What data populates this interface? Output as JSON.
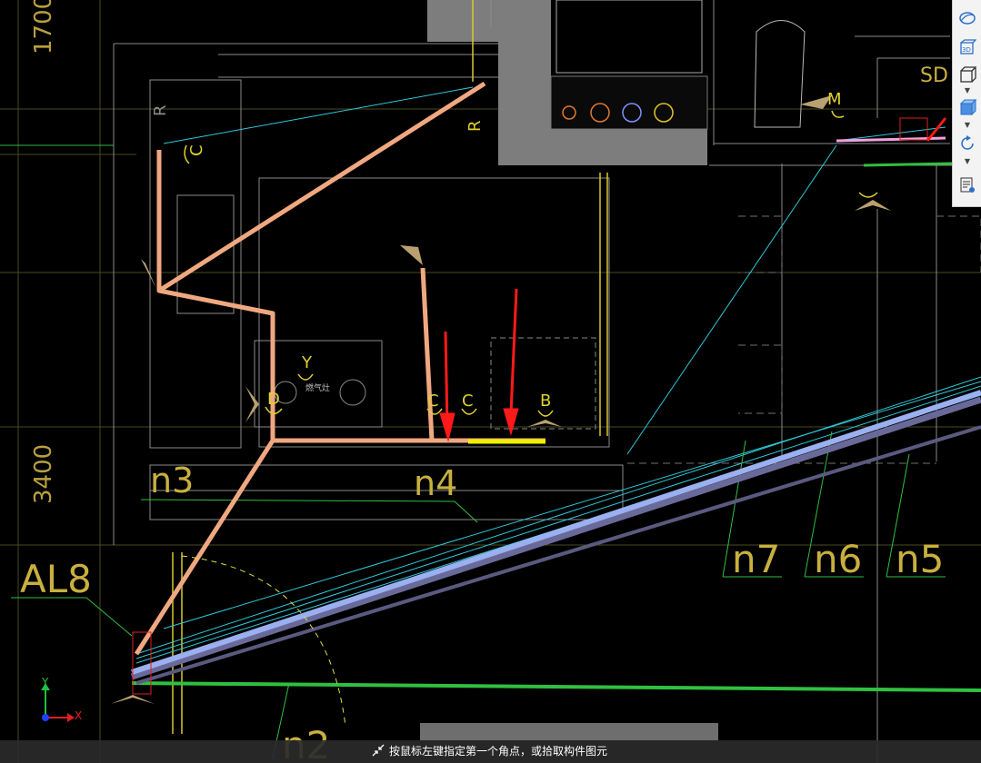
{
  "drawing": {
    "dimension_labels": [
      "1700",
      "3400"
    ],
    "room_tags": [
      "n3",
      "n4",
      "n7",
      "n6",
      "n5",
      "n2",
      "AL8",
      "SD"
    ],
    "fixture_letters": [
      "R",
      "C",
      "M",
      "Y",
      "D",
      "C",
      "C",
      "B",
      "R"
    ],
    "stove_text": "燃气灶"
  },
  "toolbar": {
    "icons": [
      "orbit-icon",
      "view-3d-icon",
      "view-cube-icon",
      "box-icon",
      "rotate-icon",
      "properties-icon"
    ],
    "view_3d_label": "3D"
  },
  "ucs": {
    "x_label": "X",
    "y_label": "Y"
  },
  "status": {
    "prompt": "按鼠标左键指定第一个角点，或拾取构件图元"
  },
  "colors": {
    "background": "#000000",
    "pipe_orange": "#f0a880",
    "pipe_blue": "#8fa8e8",
    "cyan_line": "#2fc8d8",
    "green_line": "#30c040",
    "yellow_line": "#e8e030",
    "red_arrow": "#ff1a1a",
    "tag_yellow": "#c8b040"
  }
}
